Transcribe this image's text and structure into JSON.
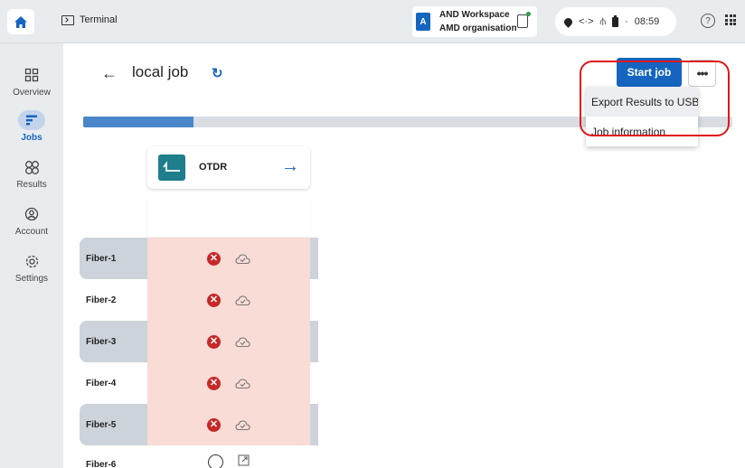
{
  "topbar": {
    "app_tab_label": "Terminal",
    "workspace": {
      "avatar_letter": "A",
      "name": "AND Workspace",
      "organisation": "AMD organisation"
    },
    "status": {
      "time": "08:59"
    }
  },
  "sidebar": {
    "items": [
      {
        "label": "Overview",
        "icon": "overview-icon"
      },
      {
        "label": "Jobs",
        "icon": "jobs-icon",
        "active": true
      },
      {
        "label": "Results",
        "icon": "results-icon"
      },
      {
        "label": "Account",
        "icon": "account-icon"
      },
      {
        "label": "Settings",
        "icon": "settings-icon"
      }
    ]
  },
  "header": {
    "title": "local job",
    "start_button_label": "Start job",
    "more_button_label": "•••"
  },
  "progress": {
    "fraction": 0.17
  },
  "dropdown": {
    "items": [
      {
        "label": "Export Results to USB"
      },
      {
        "label": "Job information"
      }
    ]
  },
  "test_column": {
    "label": "OTDR"
  },
  "fibers": [
    {
      "label": "Fiber-1",
      "status": "fail"
    },
    {
      "label": "Fiber-2",
      "status": "fail"
    },
    {
      "label": "Fiber-3",
      "status": "fail"
    },
    {
      "label": "Fiber-4",
      "status": "fail"
    },
    {
      "label": "Fiber-5",
      "status": "fail"
    },
    {
      "label": "Fiber-6",
      "status": "idle"
    }
  ],
  "colors": {
    "accent": "#1565c0",
    "fail_row": "#f8dcd5",
    "fail_icon": "#c62828",
    "highlight": "#e01818"
  }
}
